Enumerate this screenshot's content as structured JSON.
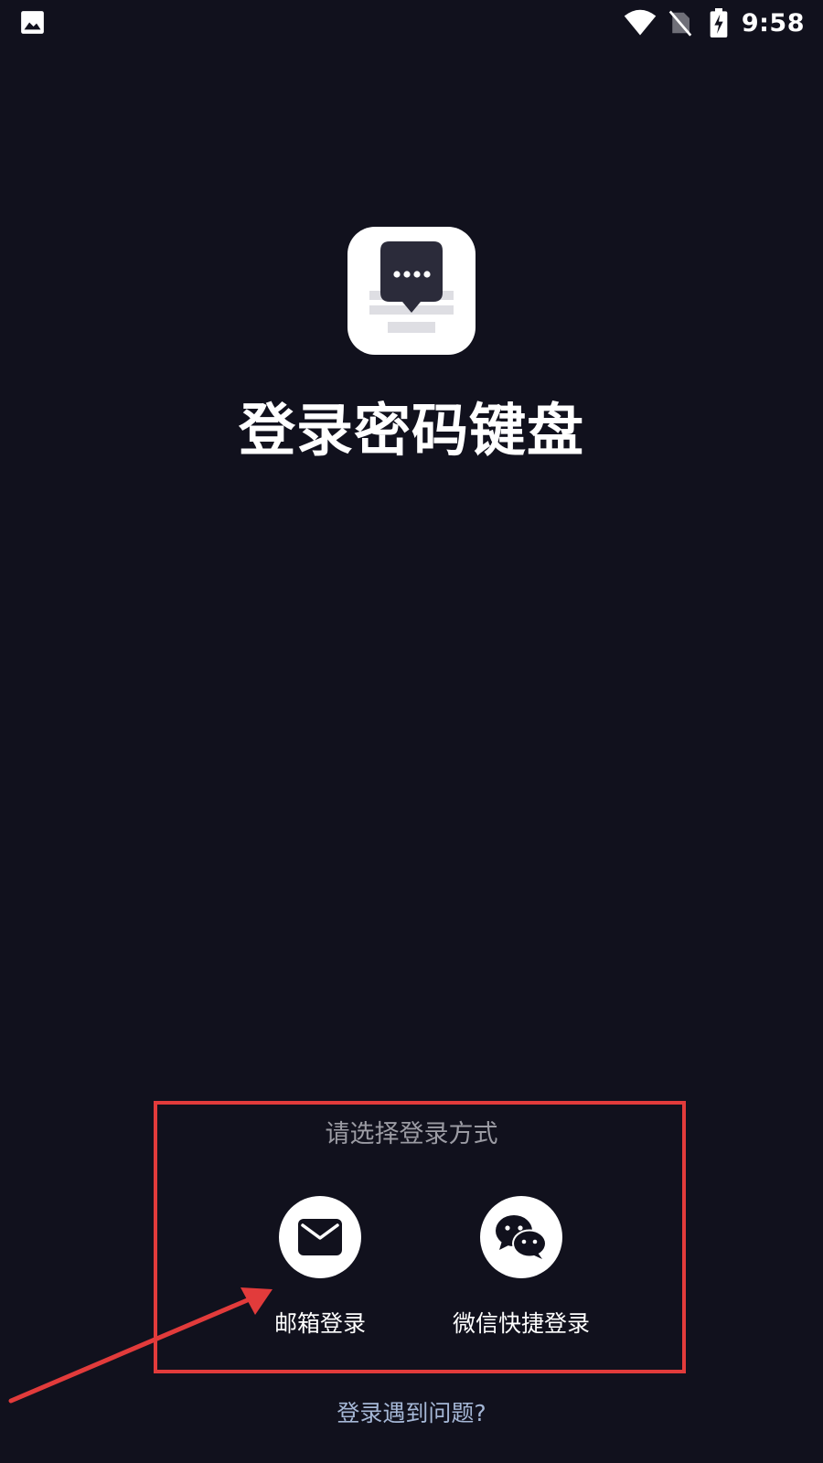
{
  "status_bar": {
    "time": "9:58",
    "icons": [
      "gallery-icon",
      "wifi-icon",
      "no-sim-icon",
      "battery-charging-icon"
    ]
  },
  "app": {
    "title": "登录密码键盘",
    "logo_icon": "keyboard-chat-logo"
  },
  "login": {
    "hint": "请选择登录方式",
    "options": [
      {
        "label": "邮箱登录",
        "icon": "mail-icon"
      },
      {
        "label": "微信快捷登录",
        "icon": "wechat-icon"
      }
    ],
    "help": "登录遇到问题?"
  },
  "colors": {
    "background": "#11111d",
    "annotation": "#e23b3b",
    "hint": "#9b9ba3",
    "link": "#a5b7d6"
  }
}
